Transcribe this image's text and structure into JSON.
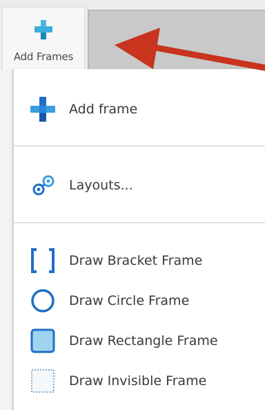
{
  "ribbon": {
    "add_frames_label": "Add Frames"
  },
  "menu": {
    "add_frame": "Add frame",
    "layouts": "Layouts...",
    "draw_bracket": "Draw Bracket Frame",
    "draw_circle": "Draw Circle Frame",
    "draw_rectangle": "Draw Rectangle Frame",
    "draw_invisible": "Draw Invisible Frame"
  },
  "colors": {
    "accent": "#1a73c9",
    "plus_teal": "#2a9fd0",
    "arrow_red": "#c8341e"
  }
}
